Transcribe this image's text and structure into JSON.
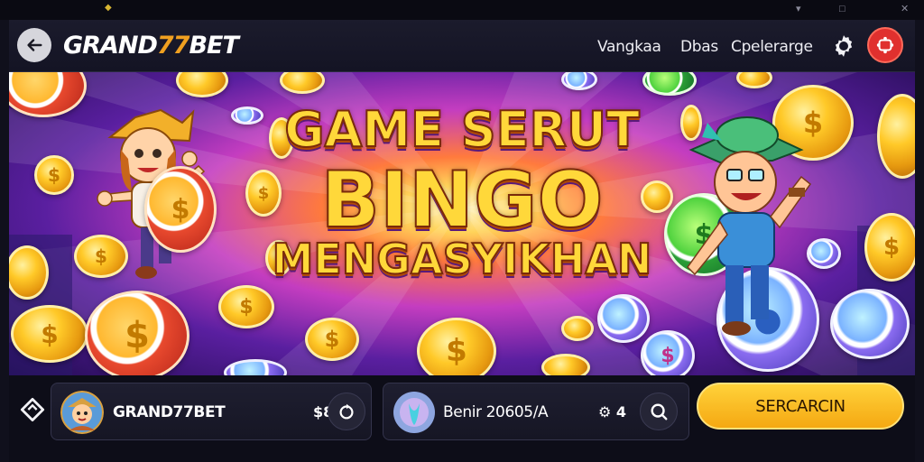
{
  "header": {
    "brand_main": "GRAND",
    "brand_accent": "77",
    "brand_tail": "BET",
    "nav": [
      "Vangkaa",
      "Dbas",
      "Cpelerarge"
    ],
    "icons": [
      "back-arrow-icon",
      "gear-icon",
      "account-icon"
    ]
  },
  "banner": {
    "line1": "GAME SERUT",
    "line2": "BINGO",
    "line3": "MENGASYIKHAN",
    "colors": {
      "headline": "#ffd83a",
      "glow": "#ff7a3d",
      "sky": "#5a1fa0"
    }
  },
  "bottom": {
    "left_icon": "diamond-icon",
    "card1": {
      "name": "GRAND77BET",
      "count": "$8",
      "icon": "refresh-icon"
    },
    "card2": {
      "name": "Benir 20605/A",
      "count": "⚙ 4",
      "icon": "search-icon"
    },
    "cta_label": "SERCARCIN",
    "cta_color": "#ffc828"
  }
}
